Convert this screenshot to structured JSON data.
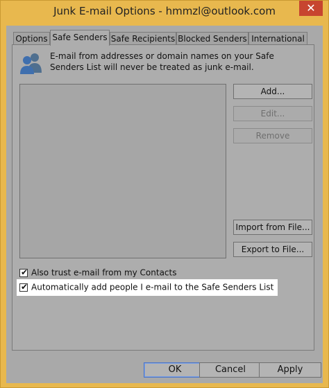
{
  "window": {
    "title": "Junk E-mail Options - hmmzl@outlook.com",
    "close_glyph": "✕"
  },
  "tabs": [
    {
      "label": "Options"
    },
    {
      "label": "Safe Senders"
    },
    {
      "label": "Safe Recipients"
    },
    {
      "label": "Blocked Senders"
    },
    {
      "label": "International"
    }
  ],
  "active_tab": "Safe Senders",
  "panel": {
    "icon": "people-icon",
    "description": "E-mail from addresses or domain names on your Safe Senders List will never be treated as junk e-mail."
  },
  "buttons": {
    "add": "Add...",
    "edit": "Edit...",
    "remove": "Remove",
    "import": "Import from File...",
    "export": "Export to File..."
  },
  "checkboxes": [
    {
      "label": "Also trust e-mail from my Contacts",
      "checked": true
    },
    {
      "label": "Automatically add people I e-mail to the Safe Senders List",
      "checked": true
    }
  ],
  "footer": {
    "ok": "OK",
    "cancel": "Cancel",
    "apply": "Apply"
  },
  "colors": {
    "frame": "#e8b84e",
    "close": "#c7452f",
    "highlight": "#ffffff"
  }
}
